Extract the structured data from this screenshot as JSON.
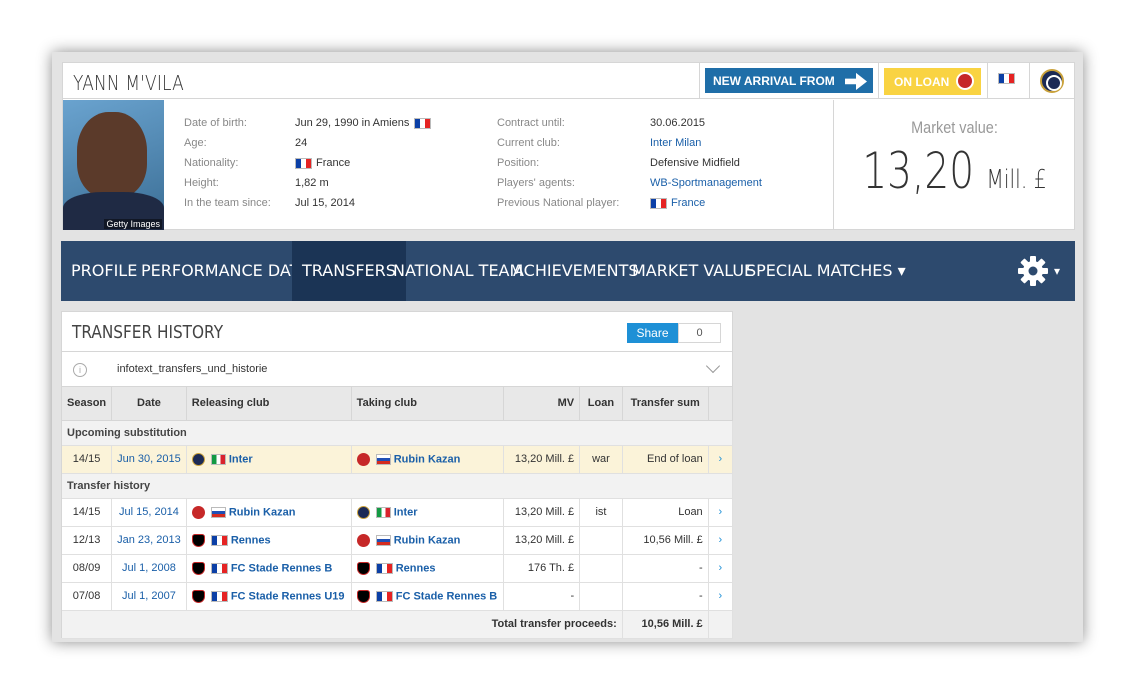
{
  "player": {
    "name": "YANN M'VILA",
    "photo_credit": "Getty Images"
  },
  "badges": {
    "arrival": "NEW ARRIVAL FROM",
    "loan": "ON LOAN"
  },
  "details_left": [
    {
      "label": "Date of birth:",
      "value": "Jun 29, 1990 in Amiens"
    },
    {
      "label": "Age:",
      "value": "24"
    },
    {
      "label": "Nationality:",
      "value": "France"
    },
    {
      "label": "Height:",
      "value": "1,82 m"
    },
    {
      "label": "In the team since:",
      "value": "Jul 15, 2014"
    }
  ],
  "details_right": [
    {
      "label": "Contract until:",
      "value": "30.06.2015"
    },
    {
      "label": "Current club:",
      "value": "Inter Milan"
    },
    {
      "label": "Position:",
      "value": "Defensive Midfield"
    },
    {
      "label": "Players' agents:",
      "value": "WB-Sportmanagement"
    },
    {
      "label": "Previous National player:",
      "value": "France"
    }
  ],
  "market_value": {
    "label": "Market value:",
    "amount": "13,20",
    "unit": "Mill. £"
  },
  "nav": {
    "items": [
      "PROFILE",
      "PERFORMANCE DATA",
      "TRANSFERS",
      "NATIONAL TEAM",
      "ACHIEVEMENTS",
      "MARKET VALUE",
      "SPECIAL MATCHES"
    ],
    "caret": "▾"
  },
  "panel": {
    "title": "TRANSFER HISTORY",
    "share_label": "Share",
    "share_count": "0",
    "info_icon": "i",
    "info_text": "infotext_transfers_und_historie"
  },
  "table": {
    "headers": [
      "Season",
      "Date",
      "Releasing club",
      "Taking club",
      "MV",
      "Loan",
      "Transfer sum"
    ],
    "group_upcoming": "Upcoming substitution",
    "group_history": "Transfer history",
    "upcoming": [
      {
        "season": "14/15",
        "date": "Jun 30, 2015",
        "from": "Inter",
        "to": "Rubin Kazan",
        "mv": "13,20 Mill. £",
        "loan": "war",
        "sum": "End of loan"
      }
    ],
    "history": [
      {
        "season": "14/15",
        "date": "Jul 15, 2014",
        "from": "Rubin Kazan",
        "to": "Inter",
        "mv": "13,20 Mill. £",
        "loan": "ist",
        "sum": "Loan"
      },
      {
        "season": "12/13",
        "date": "Jan 23, 2013",
        "from": "Rennes",
        "to": "Rubin Kazan",
        "mv": "13,20 Mill. £",
        "loan": "",
        "sum": "10,56 Mill. £"
      },
      {
        "season": "08/09",
        "date": "Jul 1, 2008",
        "from": "FC Stade Rennes B",
        "to": "Rennes",
        "mv": "176 Th. £",
        "loan": "",
        "sum": "-"
      },
      {
        "season": "07/08",
        "date": "Jul 1, 2007",
        "from": "FC Stade Rennes U19",
        "to": "FC Stade Rennes B",
        "mv": "-",
        "loan": "",
        "sum": "-"
      }
    ],
    "row_arrow": "›",
    "total_label": "Total transfer proceeds:",
    "total_value": "10,56 Mill. £"
  }
}
